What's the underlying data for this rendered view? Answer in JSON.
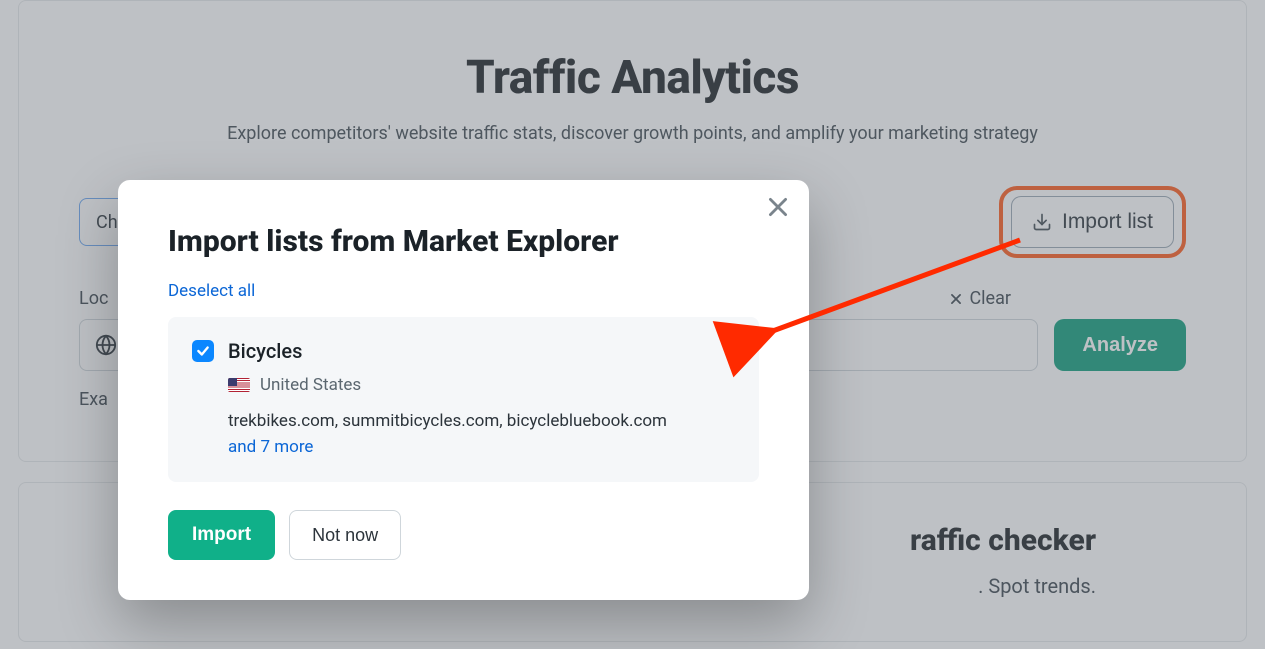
{
  "header": {
    "title": "Traffic Analytics",
    "subtitle": "Explore competitors' website traffic stats, discover growth points, and amplify your marketing strategy"
  },
  "controls": {
    "check_competitors_prefix": "Ch",
    "import_list_label": "Import list",
    "location_label": "Loc",
    "clear_label": "Clear",
    "analyze_label": "Analyze",
    "examples_label": "Exa"
  },
  "promo": {
    "heading_fragment": "raffic checker",
    "sub_fragment": ". Spot trends."
  },
  "dialog": {
    "title": "Import lists from Market Explorer",
    "deselect_label": "Deselect all",
    "list": {
      "checked": true,
      "title": "Bicycles",
      "location": "United States",
      "domains_line": "trekbikes.com, summitbicycles.com, bicyclebluebook.com",
      "more_label": "and 7 more"
    },
    "import_label": "Import",
    "not_now_label": "Not now"
  }
}
